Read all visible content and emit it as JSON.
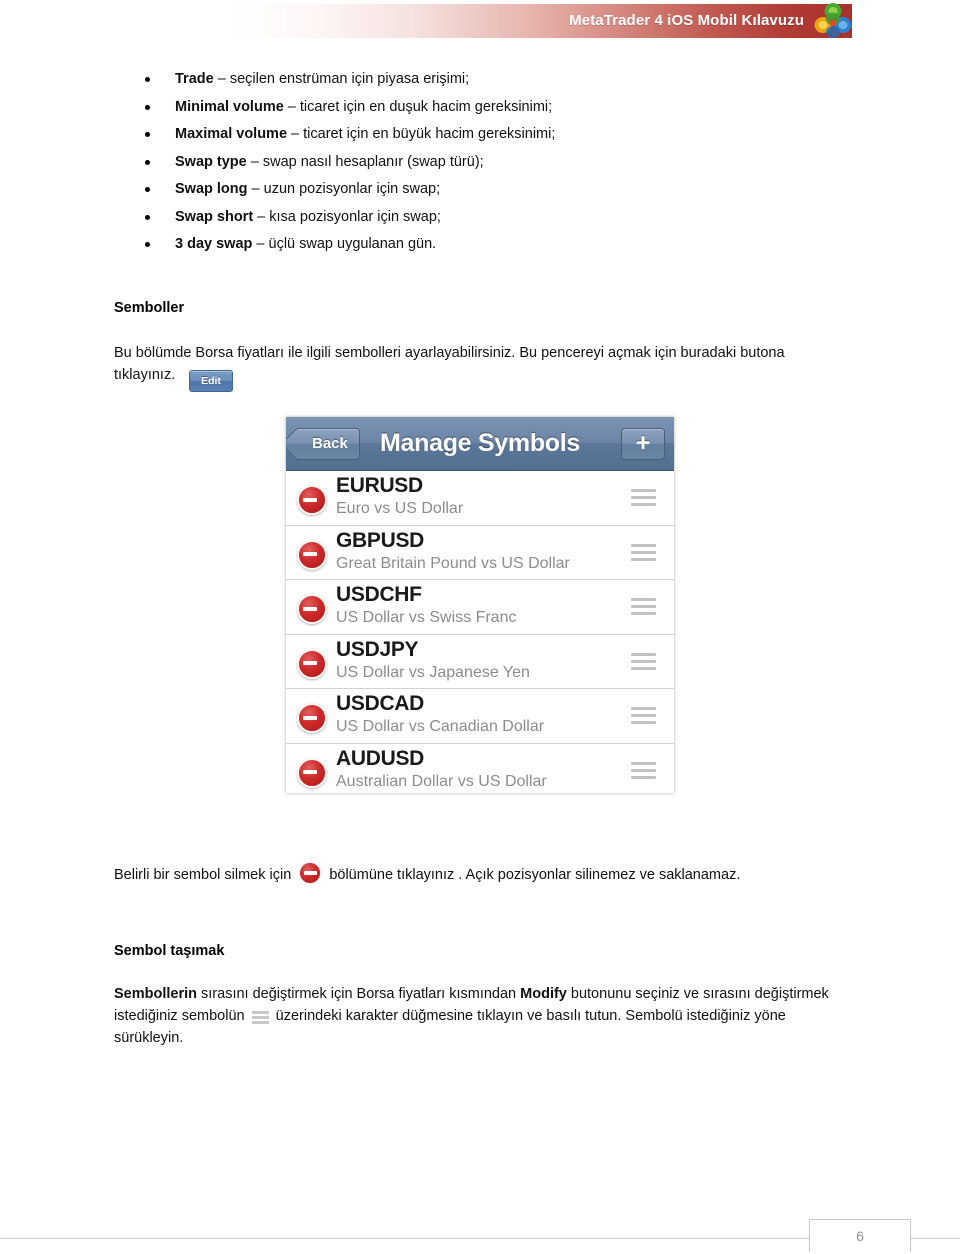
{
  "header": {
    "title": "MetaTrader 4 iOS Mobil Kılavuzu",
    "logo_icon": "metaquotes-logo-icon",
    "band_color_start": "#ffffff",
    "band_color_end": "#a8312c"
  },
  "bullets": [
    {
      "term": "Trade",
      "dash": " – ",
      "desc": "seçilen enstrüman için  piyasa erişimi;"
    },
    {
      "term": "Minimal volume",
      "dash": " – ",
      "desc": " ticaret için en duşuk hacim gereksinimi;"
    },
    {
      "term": "Maximal volume",
      "dash": " – ",
      "desc": "ticaret için en büyük hacim gereksinimi;"
    },
    {
      "term": "Swap type",
      "dash": " – ",
      "desc": "swap nasıl hesaplanır (swap türü);"
    },
    {
      "term": "Swap long",
      "dash": " – ",
      "desc": "uzun pozisyonlar için swap;"
    },
    {
      "term": "Swap short",
      "dash": " – ",
      "desc": "kısa pozisyonlar için swap;"
    },
    {
      "term": "3 day swap",
      "dash": " – ",
      "desc": "üçlü swap uygulanan gün."
    }
  ],
  "semboller": {
    "heading": "Semboller",
    "paragraph": "Bu bölümde Borsa fiyatları ile ilgili sembolleri ayarlayabilirsiniz. Bu pencereyi açmak için buradaki butona tıklayınız.",
    "edit_button_label": "Edit"
  },
  "ios_screenshot": {
    "navbar": {
      "back_label": "Back",
      "title": "Manage Symbols",
      "add_label": "+"
    },
    "rows": [
      {
        "symbol": "EURUSD",
        "description": "Euro vs US Dollar",
        "delete_icon": "minus-circle-icon",
        "handle_icon": "reorder-handle-icon"
      },
      {
        "symbol": "GBPUSD",
        "description": "Great Britain Pound vs US Dollar",
        "delete_icon": "minus-circle-icon",
        "handle_icon": "reorder-handle-icon"
      },
      {
        "symbol": "USDCHF",
        "description": "US Dollar vs Swiss Franc",
        "delete_icon": "minus-circle-icon",
        "handle_icon": "reorder-handle-icon"
      },
      {
        "symbol": "USDJPY",
        "description": "US Dollar vs Japanese Yen",
        "delete_icon": "minus-circle-icon",
        "handle_icon": "reorder-handle-icon"
      },
      {
        "symbol": "USDCAD",
        "description": "US Dollar vs Canadian Dollar",
        "delete_icon": "minus-circle-icon",
        "handle_icon": "reorder-handle-icon"
      },
      {
        "symbol": "AUDUSD",
        "description": "Australian Dollar vs US Dollar",
        "delete_icon": "minus-circle-icon",
        "handle_icon": "reorder-handle-icon"
      }
    ]
  },
  "delete_note": {
    "before_icon": "Belirli bir sembol silmek için ",
    "after_icon": " bölümüne tıklayınız . Açık pozisyonlar silinemez ve saklanamaz."
  },
  "sembol_tasimak": {
    "heading": "Sembol taşımak",
    "part1_bold": "Sembollerin",
    "part2": " sırasını değiştirmek için Borsa fiyatları kısmından ",
    "part3_bold": "Modify",
    "part4": " butonunu seçiniz ve  sırasını değiştirmek istediğiniz sembolün ",
    "part5": " üzerindeki karakter düğmesine tıklayın ve basılı tutun.  Sembolü istediğiniz yöne sürükleyin."
  },
  "footer": {
    "page_number": "6"
  }
}
